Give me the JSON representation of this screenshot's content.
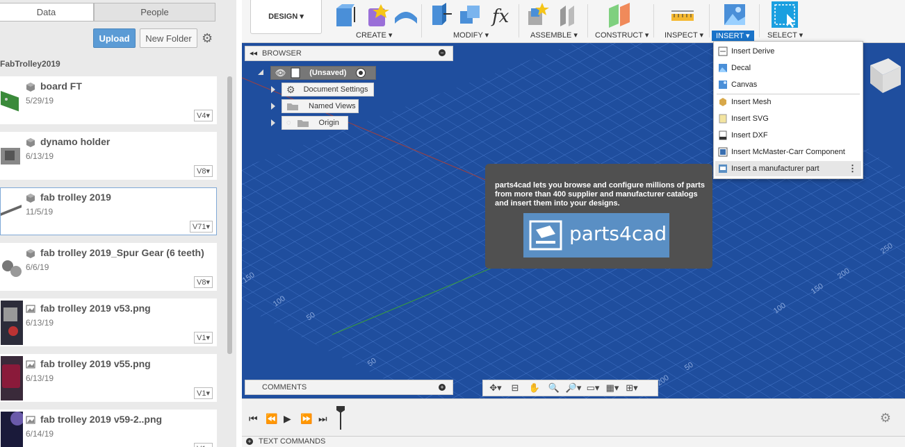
{
  "data_panel": {
    "tabs": [
      "Data",
      "People"
    ],
    "upload_label": "Upload",
    "new_folder_label": "New Folder",
    "project_name": "FabTrolley2019",
    "files": [
      {
        "name": "board FT",
        "date": "5/29/19",
        "version": "V4",
        "type": "design"
      },
      {
        "name": "dynamo holder",
        "date": "6/13/19",
        "version": "V8",
        "type": "design"
      },
      {
        "name": "fab trolley 2019",
        "date": "11/5/19",
        "version": "V71",
        "type": "design",
        "selected": true
      },
      {
        "name": "fab trolley 2019_Spur Gear (6 teeth)",
        "date": "6/6/19",
        "version": "V8",
        "type": "design"
      },
      {
        "name": "fab trolley 2019 v53.png",
        "date": "6/13/19",
        "version": "V1",
        "type": "image"
      },
      {
        "name": "fab trolley 2019 v55.png",
        "date": "6/13/19",
        "version": "V1",
        "type": "image"
      },
      {
        "name": "fab trolley 2019 v59-2..png",
        "date": "6/14/19",
        "version": "V1",
        "type": "image"
      }
    ]
  },
  "toolbar": {
    "workspace": "DESIGN",
    "groups": [
      {
        "label": "CREATE"
      },
      {
        "label": "MODIFY"
      },
      {
        "label": "ASSEMBLE"
      },
      {
        "label": "CONSTRUCT"
      },
      {
        "label": "INSPECT"
      },
      {
        "label": "INSERT",
        "active": true
      },
      {
        "label": "SELECT"
      }
    ]
  },
  "browser": {
    "title": "BROWSER",
    "root": "(Unsaved)",
    "items": [
      "Document Settings",
      "Named Views",
      "Origin"
    ]
  },
  "insert_menu": {
    "items": [
      {
        "label": "Insert Derive",
        "icon": "derive-icon"
      },
      {
        "label": "Decal",
        "icon": "decal-icon"
      },
      {
        "label": "Canvas",
        "icon": "canvas-icon"
      },
      {
        "label": "Insert Mesh",
        "icon": "mesh-icon"
      },
      {
        "label": "Insert SVG",
        "icon": "svg-icon"
      },
      {
        "label": "Insert DXF",
        "icon": "dxf-icon"
      },
      {
        "label": "Insert McMaster-Carr Component",
        "icon": "mcmaster-icon"
      },
      {
        "label": "Insert a manufacturer part",
        "icon": "manufacturer-part-icon",
        "hover": true
      }
    ]
  },
  "tooltip": {
    "text": "parts4cad lets you browse and configure millions of parts from more than 400 supplier and manufacturer catalogs and insert them into your designs.",
    "logo_text": "parts4cad"
  },
  "grid_labels": [
    "250",
    "200",
    "150",
    "100",
    "50",
    "50",
    "100",
    "150",
    "200",
    "100",
    "50"
  ],
  "comments_label": "COMMENTS",
  "text_commands_label": "TEXT COMMANDS",
  "colors": {
    "accent": "#1a73c9",
    "canvas": "#1f4e9e",
    "upload": "#5b9bd5",
    "tooltip": "#505050"
  }
}
